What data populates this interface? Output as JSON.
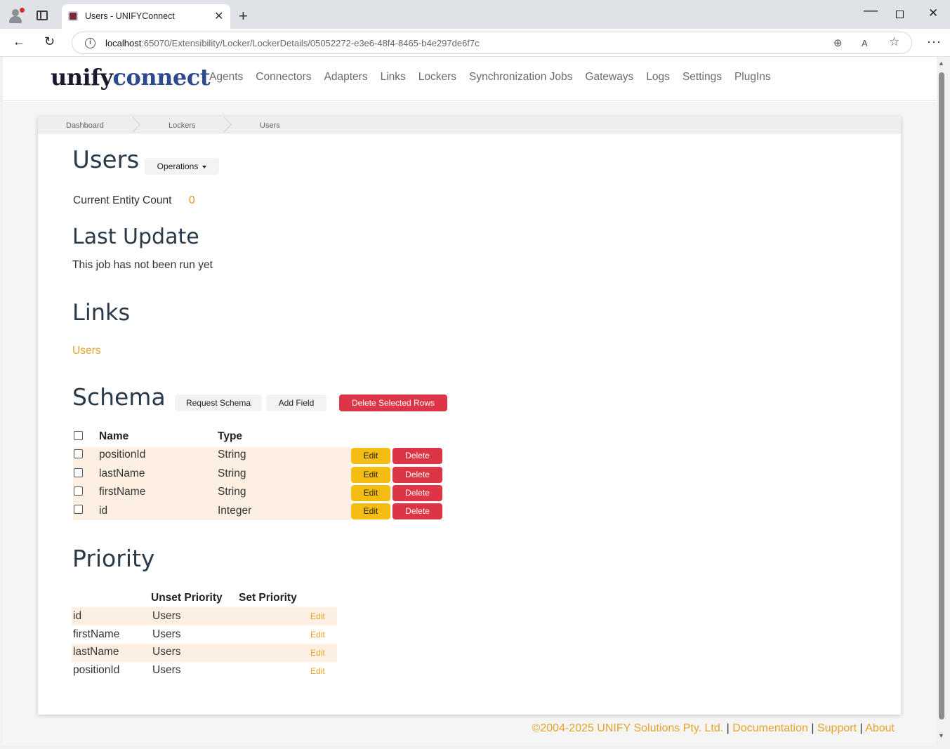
{
  "browser": {
    "tab_title": "Users - UNIFYConnect",
    "url_host": "localhost",
    "url_rest": ":65070/Extensibility/Locker/LockerDetails/05052272-e3e6-48f4-8465-b4e297de6f7c"
  },
  "site": {
    "logo_part1": "unify",
    "logo_part2": "connect",
    "nav": [
      "Agents",
      "Connectors",
      "Adapters",
      "Links",
      "Lockers",
      "Synchronization Jobs",
      "Gateways",
      "Logs",
      "Settings",
      "PlugIns"
    ]
  },
  "breadcrumb": [
    "Dashboard",
    "Lockers",
    "Users"
  ],
  "page": {
    "title": "Users",
    "operations_label": "Operations",
    "entity_count_label": "Current Entity Count",
    "entity_count_value": "0",
    "last_update_title": "Last Update",
    "last_update_text": "This job has not been run yet",
    "links_title": "Links",
    "links": [
      "Users"
    ]
  },
  "schema": {
    "title": "Schema",
    "request_schema_label": "Request Schema",
    "add_field_label": "Add Field",
    "delete_selected_label": "Delete Selected Rows",
    "col_name": "Name",
    "col_type": "Type",
    "edit_label": "Edit",
    "delete_label": "Delete",
    "rows": [
      {
        "name": "positionId",
        "type": "String"
      },
      {
        "name": "lastName",
        "type": "String"
      },
      {
        "name": "firstName",
        "type": "String"
      },
      {
        "name": "id",
        "type": "Integer"
      }
    ]
  },
  "priority": {
    "title": "Priority",
    "col_unset": "Unset Priority",
    "col_set": "Set Priority",
    "edit_label": "Edit",
    "rows": [
      {
        "field": "id",
        "unset": "Users",
        "set": ""
      },
      {
        "field": "firstName",
        "unset": "Users",
        "set": ""
      },
      {
        "field": "lastName",
        "unset": "Users",
        "set": ""
      },
      {
        "field": "positionId",
        "unset": "Users",
        "set": ""
      }
    ]
  },
  "footer": {
    "copyright": "©2004-2025 UNIFY Solutions Pty. Ltd.",
    "links": [
      "Documentation",
      "Support",
      "About"
    ]
  }
}
